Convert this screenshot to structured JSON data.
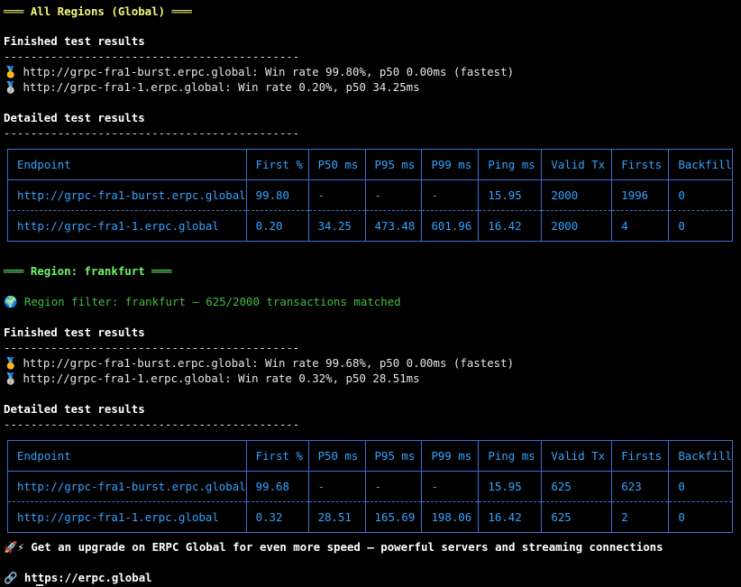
{
  "sections": [
    {
      "heading": "═══ All Regions (Global) ═══",
      "finished_title": "Finished test results",
      "divider": "--------------------------------------------",
      "results": [
        {
          "medal": "🥇",
          "text": "http://grpc-fra1-burst.erpc.global: Win rate 99.80%, p50 0.00ms (fastest)"
        },
        {
          "medal": "🥈",
          "text": "http://grpc-fra1-1.erpc.global: Win rate 0.20%, p50 34.25ms"
        }
      ],
      "detailed_title": "Detailed test results",
      "table": {
        "headers": [
          "Endpoint",
          "First %",
          "P50 ms",
          "P95 ms",
          "P99 ms",
          "Ping ms",
          "Valid Tx",
          "Firsts",
          "Backfill"
        ],
        "rows": [
          [
            "http://grpc-fra1-burst.erpc.global",
            "99.80",
            "-",
            "-",
            "-",
            "15.95",
            "2000",
            "1996",
            "0"
          ],
          [
            "http://grpc-fra1-1.erpc.global",
            "0.20",
            "34.25",
            "473.48",
            "601.96",
            "16.42",
            "2000",
            "4",
            "0"
          ]
        ]
      }
    },
    {
      "heading": "═══ Region: frankfurt ═══",
      "filter_line": "🌍 Region filter: frankfurt – 625/2000 transactions matched",
      "finished_title": "Finished test results",
      "divider": "--------------------------------------------",
      "results": [
        {
          "medal": "🥇",
          "text": "http://grpc-fra1-burst.erpc.global: Win rate 99.68%, p50 0.00ms (fastest)"
        },
        {
          "medal": "🥈",
          "text": "http://grpc-fra1-1.erpc.global: Win rate 0.32%, p50 28.51ms"
        }
      ],
      "detailed_title": "Detailed test results",
      "table": {
        "headers": [
          "Endpoint",
          "First %",
          "P50 ms",
          "P95 ms",
          "P99 ms",
          "Ping ms",
          "Valid Tx",
          "Firsts",
          "Backfill"
        ],
        "rows": [
          [
            "http://grpc-fra1-burst.erpc.global",
            "99.68",
            "-",
            "-",
            "-",
            "15.95",
            "625",
            "623",
            "0"
          ],
          [
            "http://grpc-fra1-1.erpc.global",
            "0.32",
            "28.51",
            "165.69",
            "198.06",
            "16.42",
            "625",
            "2",
            "0"
          ]
        ]
      }
    }
  ],
  "promo": "🚀⚡ Get an upgrade on ERPC Global for even more speed – powerful servers and streaming connections",
  "link": "🔗 https://erpc.global",
  "colors": {
    "background": "#000000",
    "table_border": "#3b6fd6",
    "table_text": "#36a3ff",
    "heading_yellow": "#f5f57a",
    "heading_green": "#6ef56e"
  }
}
